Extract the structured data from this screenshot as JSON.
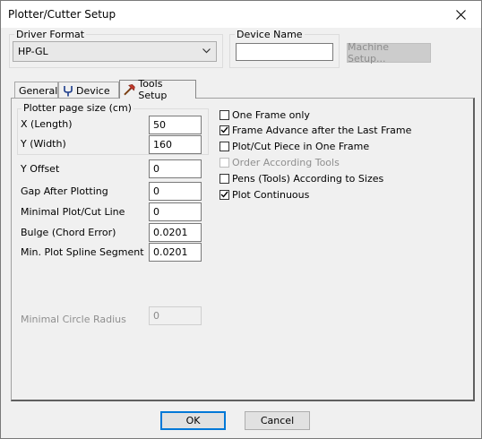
{
  "window": {
    "title": "Plotter/Cutter Setup",
    "close_glyph": "✕"
  },
  "driver_format": {
    "label": "Driver Format",
    "selected": "HP-GL"
  },
  "device_name": {
    "label": "Device Name",
    "value": ""
  },
  "machine_setup": {
    "label": "Machine Setup..."
  },
  "tabs": [
    {
      "label": "General",
      "icon": null
    },
    {
      "label": "Device",
      "icon": "tuning-fork-icon"
    },
    {
      "label": "Tools Setup",
      "icon": "hammer-icon"
    }
  ],
  "page_size": {
    "group_label": "Plotter page size (cm)",
    "x_label": "X (Length)",
    "x_value": "50",
    "y_label": "Y (Width)",
    "y_value": "160"
  },
  "fields": {
    "y_offset": {
      "label": "Y Offset",
      "value": "0"
    },
    "gap_after": {
      "label": "Gap After Plotting",
      "value": "0"
    },
    "min_line": {
      "label": "Minimal Plot/Cut Line",
      "value": "0"
    },
    "bulge": {
      "label": "Bulge (Chord Error)",
      "value": "0.0201"
    },
    "min_spline": {
      "label": "Min. Plot Spline Segment",
      "value": "0.0201"
    },
    "min_circle": {
      "label": "Minimal Circle Radius",
      "value": "0"
    }
  },
  "options": [
    {
      "label": "One Frame only",
      "checked": false,
      "enabled": true
    },
    {
      "label": "Frame Advance after the Last Frame",
      "checked": true,
      "enabled": true
    },
    {
      "label": "Plot/Cut Piece in One Frame",
      "checked": false,
      "enabled": true
    },
    {
      "label": "Order According Tools",
      "checked": false,
      "enabled": false
    },
    {
      "label": "Pens (Tools) According to Sizes",
      "checked": false,
      "enabled": true
    },
    {
      "label": "Plot Continuous",
      "checked": true,
      "enabled": true
    }
  ],
  "buttons": {
    "ok": "OK",
    "cancel": "Cancel"
  },
  "colors": {
    "accent": "#0078d7",
    "dialog_bg": "#f0f0f0",
    "title_bg": "#ffffff"
  }
}
